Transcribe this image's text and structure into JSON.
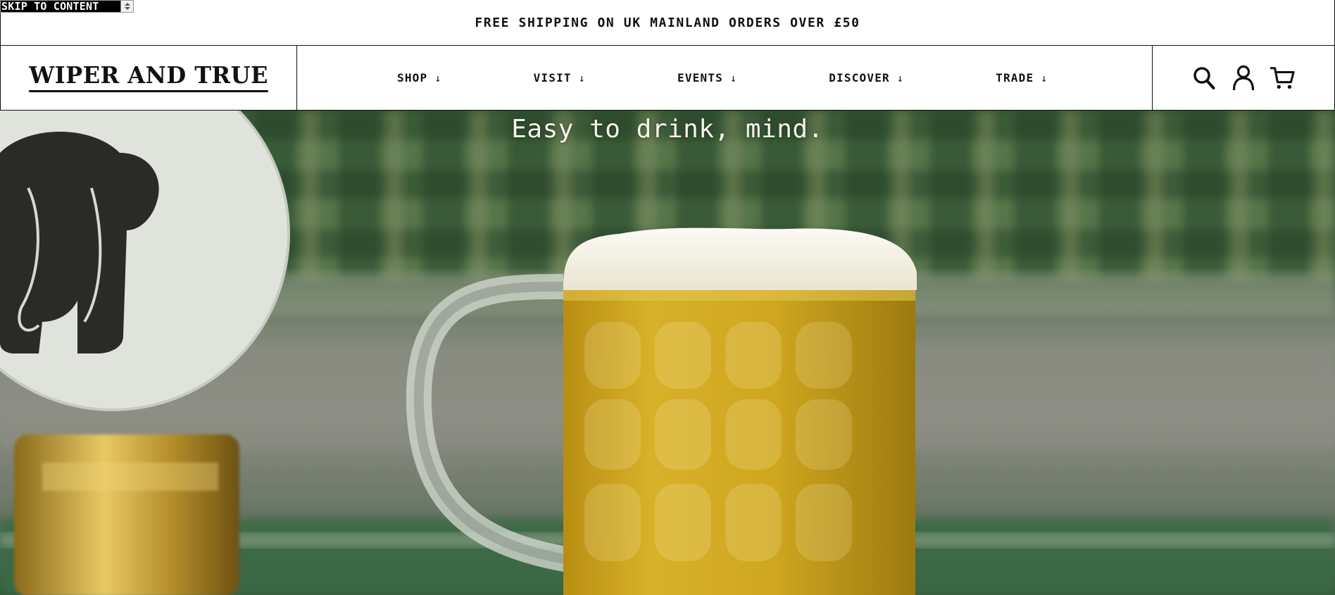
{
  "skip_link": {
    "label": "SKIP TO CONTENT"
  },
  "announcement": {
    "text": "FREE SHIPPING ON UK MAINLAND ORDERS OVER £50"
  },
  "header": {
    "logo_text": "WIPER AND TRUE",
    "nav": [
      {
        "label": "SHOP",
        "arrow": "↓"
      },
      {
        "label": "VISIT",
        "arrow": "↓"
      },
      {
        "label": "EVENTS",
        "arrow": "↓"
      },
      {
        "label": "DISCOVER",
        "arrow": "↓"
      },
      {
        "label": "TRADE",
        "arrow": "↓"
      }
    ],
    "icons": [
      "search-icon",
      "account-icon",
      "cart-icon"
    ]
  },
  "hero": {
    "tagline": "Easy to drink, mind."
  },
  "colors": {
    "text": "#111111",
    "background": "#ffffff",
    "tagline": "#f6f3ea",
    "beer": "#c9a21a",
    "foam": "#f4f1e6",
    "plaid_green": "#2b4a2c"
  }
}
